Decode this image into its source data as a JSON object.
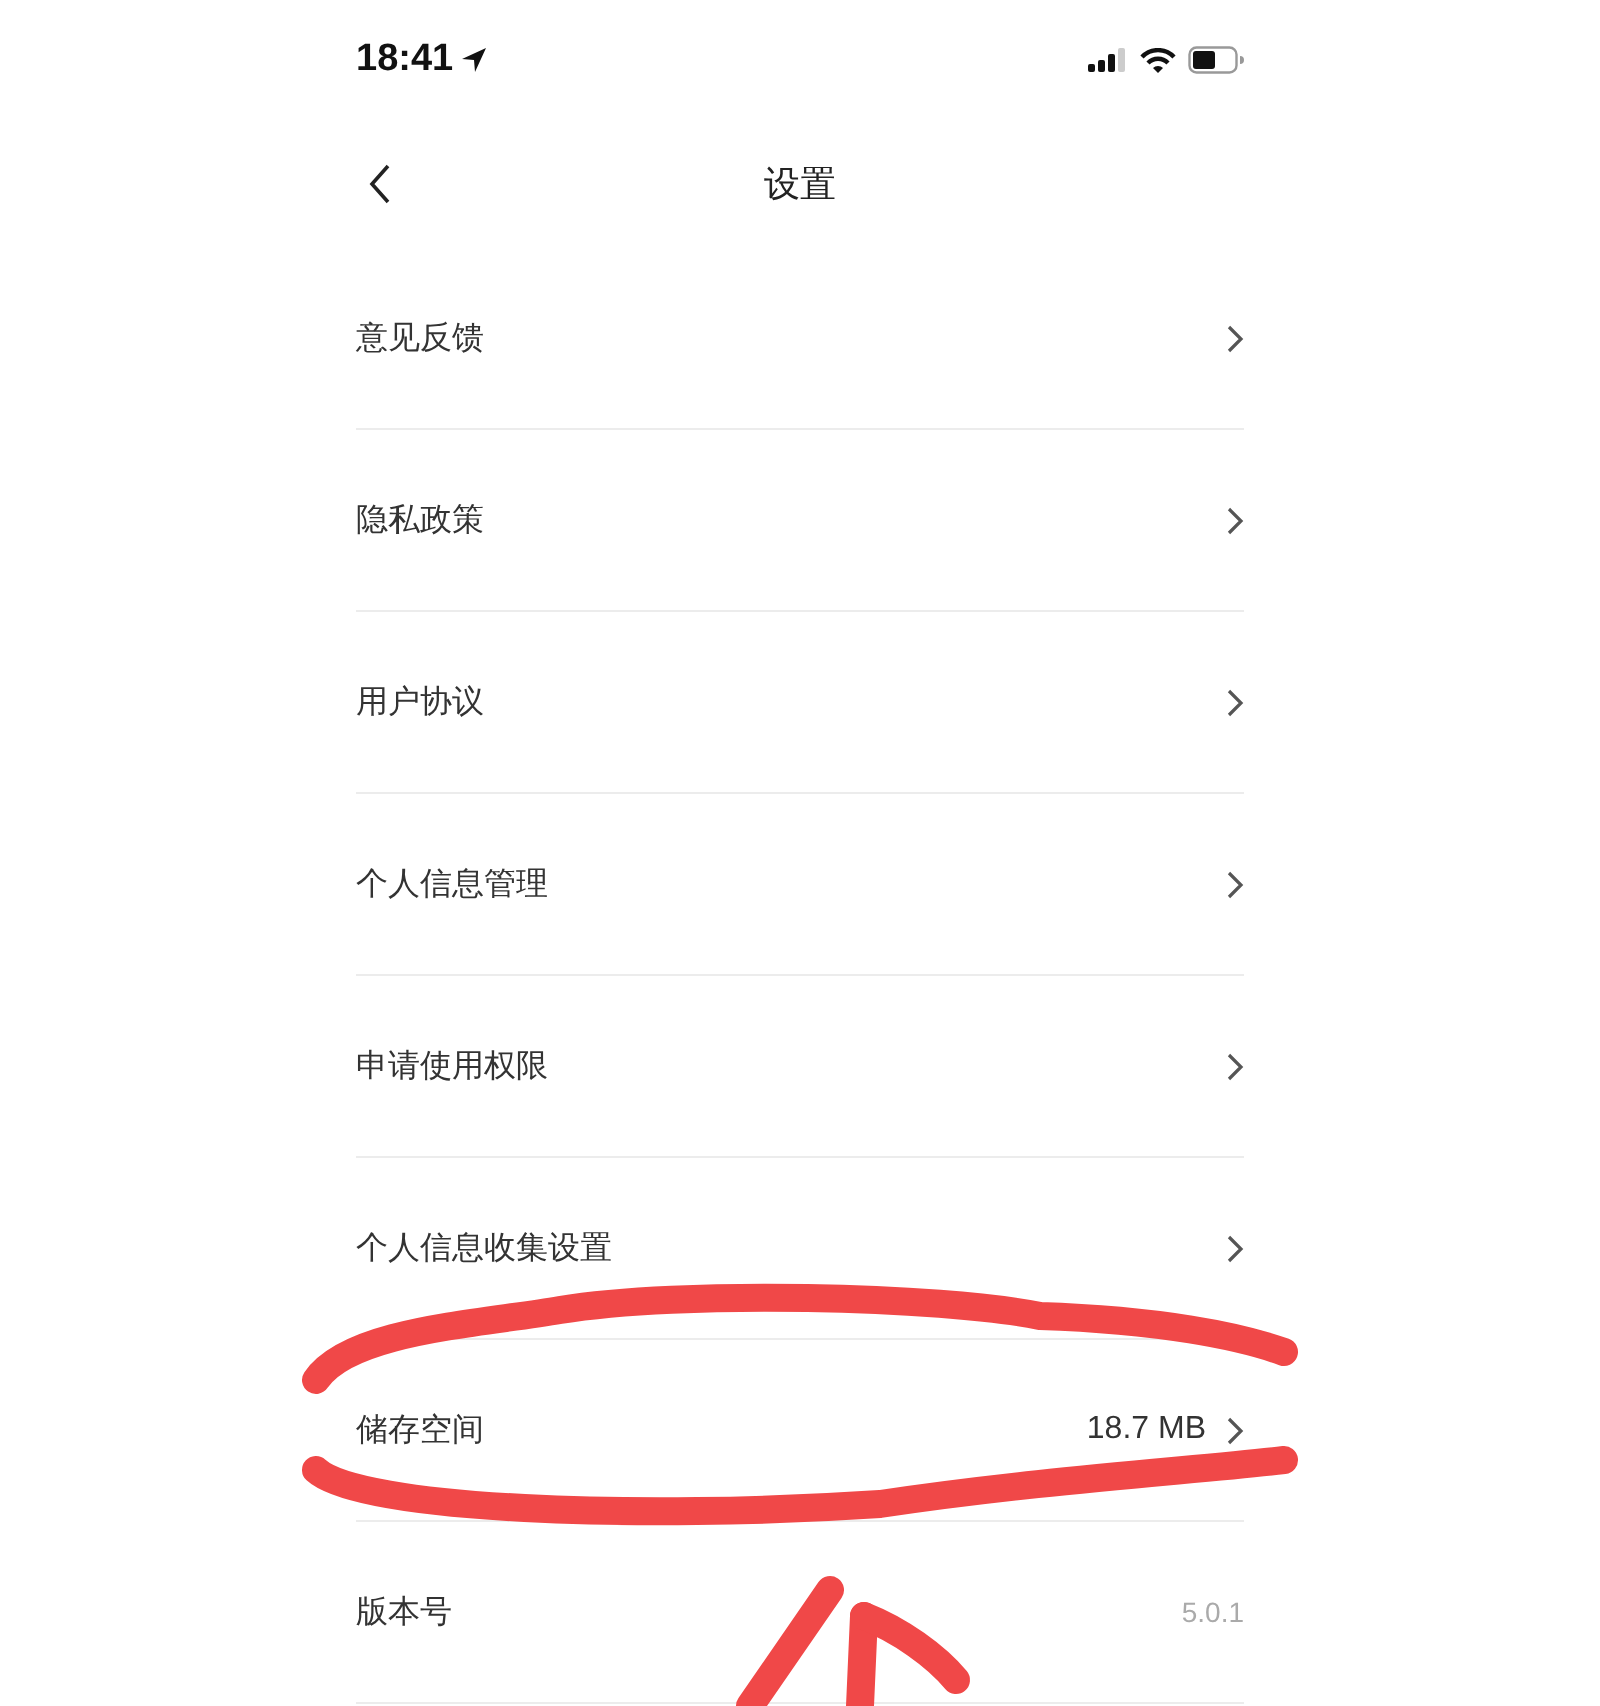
{
  "status_bar": {
    "time": "18:41"
  },
  "nav_bar": {
    "title": "设置"
  },
  "settings": [
    {
      "kind": "link",
      "label": "意见反馈"
    },
    {
      "kind": "link",
      "label": "隐私政策"
    },
    {
      "kind": "link",
      "label": "用户协议"
    },
    {
      "kind": "link",
      "label": "个人信息管理"
    },
    {
      "kind": "link",
      "label": "申请使用权限"
    },
    {
      "kind": "link",
      "label": "个人信息收集设置"
    },
    {
      "kind": "link",
      "label": "储存空间",
      "value": "18.7 MB"
    },
    {
      "kind": "info",
      "label": "版本号",
      "value": "5.0.1"
    }
  ]
}
